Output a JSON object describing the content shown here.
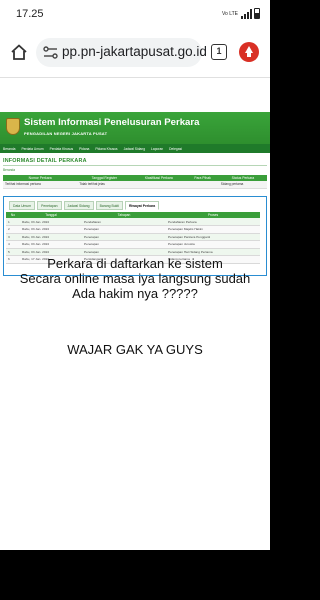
{
  "status_bar": {
    "time": "17.25",
    "network": "Vo LTE"
  },
  "browser": {
    "url": "pp.pn-jakartapusat.go.id",
    "tab_count": "1"
  },
  "site": {
    "title": "Sistem Informasi Penelusuran Perkara",
    "subtitle": "PENGADILAN NEGERI JAKARTA PUSAT",
    "nav": [
      "Beranda",
      "Perdata Umum",
      "Perdata Khusus",
      "Pidana",
      "Pidana Khusus",
      "Jadwal Sidang",
      "Laporan",
      "Delegasi"
    ],
    "panel_title": "INFORMASI DETAIL PERKARA",
    "breadcrumb": "Beranda",
    "case_headers": [
      "Nomor Perkara",
      "Tanggal Register",
      "Klasifikasi Perkara",
      "Para Pihak",
      "Status Perkara"
    ],
    "case_row": [
      "Terlihat informasi perkara",
      "Tidak terlihat jelas",
      "",
      "",
      "Sidang pertama"
    ],
    "tabs": [
      "Data Umum",
      "Penetapan",
      "Jadwal Sidang",
      "Barang Bukti",
      "Riwayat Perkara"
    ],
    "active_tab": "Riwayat Perkara",
    "history_headers": [
      "No",
      "Tanggal",
      "Tahapan",
      "Proses"
    ],
    "history_rows": [
      [
        "1",
        "Rabu, 03 Jan. 2024",
        "Pendaftaran",
        "Pendaftaran Perkara"
      ],
      [
        "2",
        "Rabu, 03 Jan. 2024",
        "Penetapan",
        "Penetapan Majelis Hakim"
      ],
      [
        "3",
        "Rabu, 03 Jan. 2024",
        "Penetapan",
        "Penetapan Panitera Pengganti"
      ],
      [
        "4",
        "Rabu, 03 Jan. 2024",
        "Penetapan",
        "Penetapan Jurusita"
      ],
      [
        "5",
        "Rabu, 03 Jan. 2024",
        "Penetapan",
        "Penetapan Hari Sidang Pertama"
      ],
      [
        "6",
        "Rabu, 17 Jan. 2024",
        "Persidangan",
        "Sidang pertama"
      ]
    ]
  },
  "caption": {
    "lines": [
      "Perkara di daftarkan ke sistem",
      "Secara online masa iya langsung sudah",
      "Ada hakim nya ?????"
    ],
    "shout": "WAJAR GAK YA GUYS"
  }
}
